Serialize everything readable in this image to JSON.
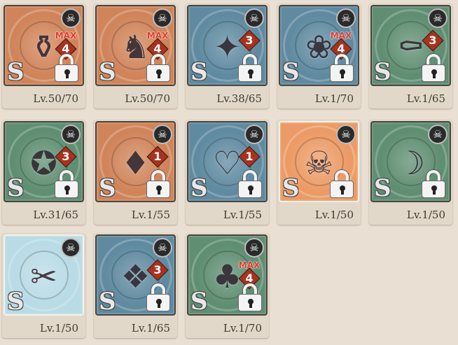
{
  "elements": {
    "rank_letter": "S",
    "max_label": "MAX",
    "element_glyph": "☠"
  },
  "colors": {
    "fire": "#d0845a",
    "water": "#5f8aa0",
    "wind": "#5f8e72",
    "light": "#b9dbe6",
    "orange": "#ec9b66"
  },
  "cards": [
    {
      "level": "Lv.50/70",
      "uncap": "4",
      "show_max": true,
      "locked": true,
      "bg": "fire",
      "art": "⚱",
      "art_name": "glass-bottle-icon"
    },
    {
      "level": "Lv.50/70",
      "uncap": "4",
      "show_max": true,
      "locked": true,
      "bg": "fire",
      "art": "♞",
      "art_name": "armored-doll-icon"
    },
    {
      "level": "Lv.38/65",
      "uncap": "3",
      "show_max": false,
      "locked": true,
      "bg": "water",
      "art": "✦",
      "art_name": "blue-gem-icon"
    },
    {
      "level": "Lv.1/70",
      "uncap": "4",
      "show_max": true,
      "locked": true,
      "bg": "water",
      "art": "❀",
      "art_name": "flower-brooch-icon"
    },
    {
      "level": "Lv.1/65",
      "uncap": "3",
      "show_max": false,
      "locked": true,
      "bg": "wind",
      "art": "⚰",
      "art_name": "coffin-icon"
    },
    {
      "level": "Lv.31/65",
      "uncap": "3",
      "show_max": false,
      "locked": true,
      "bg": "wind",
      "art": "✪",
      "art_name": "ornate-shield-icon"
    },
    {
      "level": "Lv.1/55",
      "uncap": "1",
      "show_max": false,
      "locked": true,
      "bg": "fire",
      "art": "♦",
      "art_name": "red-jewel-icon"
    },
    {
      "level": "Lv.1/55",
      "uncap": "1",
      "show_max": false,
      "locked": true,
      "bg": "water",
      "art": "♡",
      "art_name": "heart-charm-icon"
    },
    {
      "level": "Lv.1/50",
      "uncap": "",
      "show_max": false,
      "locked": true,
      "bg": "orange",
      "art": "☠",
      "art_name": "skull-creature-icon",
      "glow": true
    },
    {
      "level": "Lv.1/50",
      "uncap": "",
      "show_max": false,
      "locked": true,
      "bg": "wind",
      "art": "☽",
      "art_name": "dark-figure-icon"
    },
    {
      "level": "Lv.1/50",
      "uncap": "",
      "show_max": false,
      "locked": false,
      "bg": "light",
      "art": "✂",
      "art_name": "ribbon-charm-icon",
      "glow": true
    },
    {
      "level": "Lv.1/65",
      "uncap": "3",
      "show_max": false,
      "locked": true,
      "bg": "water",
      "art": "❖",
      "art_name": "blue-orb-icon"
    },
    {
      "level": "Lv.1/70",
      "uncap": "4",
      "show_max": true,
      "locked": true,
      "bg": "wind",
      "art": "♣",
      "art_name": "scarecrow-icon"
    }
  ]
}
